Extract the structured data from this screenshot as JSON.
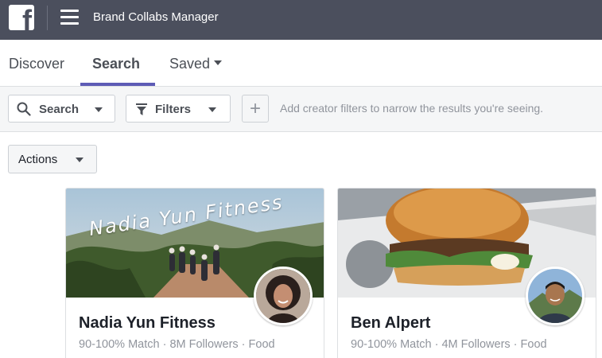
{
  "header": {
    "logo_letter": "f",
    "app_title": "Brand Collabs Manager"
  },
  "tabs": [
    {
      "label": "Discover",
      "active": false
    },
    {
      "label": "Search",
      "active": true
    },
    {
      "label": "Saved",
      "active": false
    }
  ],
  "filter_bar": {
    "search_label": "Search",
    "filters_label": "Filters",
    "add_icon": "plus-icon",
    "hint": "Add creator filters to narrow the results you're seeing."
  },
  "actions": {
    "label": "Actions"
  },
  "creators": [
    {
      "name": "Nadia Yun Fitness",
      "cover_text": "Nadia Yun Fitness",
      "meta": "90-100% Match · 8M Followers · Food"
    },
    {
      "name": "Ben Alpert",
      "meta": "90-100% Match · 4M Followers · Food"
    }
  ],
  "colors": {
    "topbar": "#4b4f5d",
    "accent": "#5d5bb5",
    "muted_text": "#90949c"
  }
}
